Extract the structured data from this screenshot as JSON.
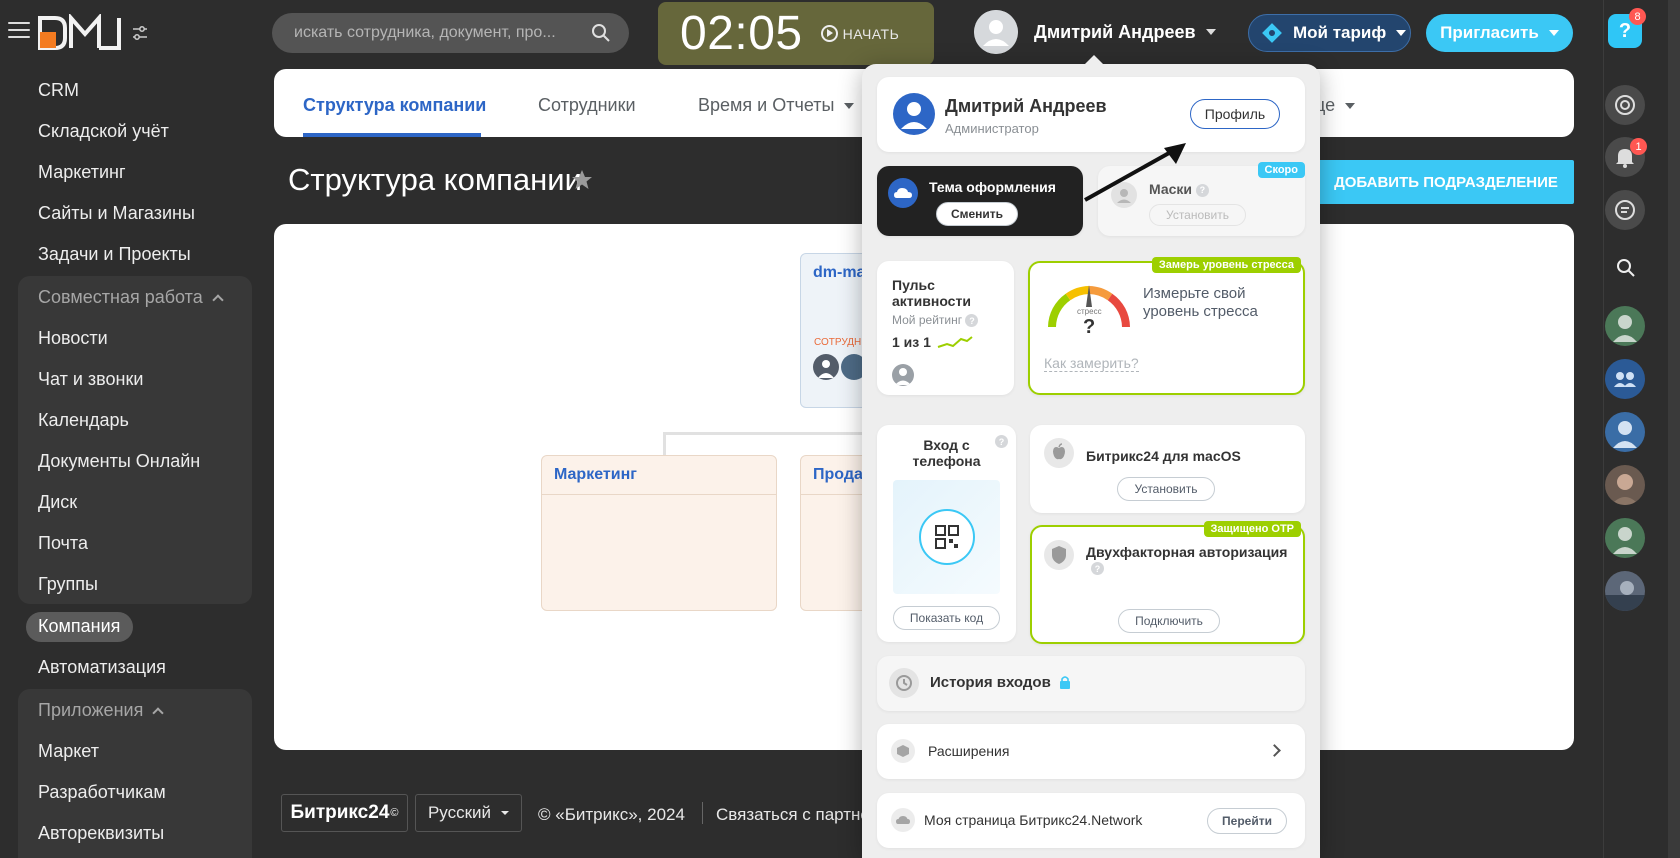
{
  "topbar": {
    "search_placeholder": "искать сотрудника, документ, про...",
    "timer": "02:05",
    "timer_start": "НАЧАТЬ",
    "user_name": "Дмитрий Андреев",
    "tariff_label": "Мой тариф",
    "invite_label": "Пригласить"
  },
  "rail": {
    "help_badge": "8",
    "notifications_badge": "1"
  },
  "sidebar": {
    "items": [
      {
        "label": "CRM"
      },
      {
        "label": "Складской учёт"
      },
      {
        "label": "Маркетинг"
      },
      {
        "label": "Сайты и Магазины"
      },
      {
        "label": "Задачи и Проекты"
      }
    ],
    "collab_title": "Совместная работа",
    "collab_items": [
      {
        "label": "Новости"
      },
      {
        "label": "Чат и звонки"
      },
      {
        "label": "Календарь"
      },
      {
        "label": "Документы Онлайн"
      },
      {
        "label": "Диск"
      },
      {
        "label": "Почта"
      },
      {
        "label": "Группы"
      }
    ],
    "company": "Компания",
    "automation": "Автоматизация",
    "apps_title": "Приложения",
    "apps_items": [
      {
        "label": "Маркет"
      },
      {
        "label": "Разработчикам"
      },
      {
        "label": "Автореквизиты"
      }
    ]
  },
  "main": {
    "tabs": [
      {
        "label": "Структура компании"
      },
      {
        "label": "Сотрудники"
      },
      {
        "label": "Время и Отчеты"
      },
      {
        "label": "це"
      }
    ],
    "title": "Структура компании",
    "add_button": "ДОБАВИТЬ ПОДРАЗДЕЛЕНИЕ",
    "root_card_title": "dm-ma",
    "root_card_sub": "СОТРУДНИ",
    "dept_marketing": "Маркетинг",
    "dept_sales": "Прода"
  },
  "footer": {
    "logo": "Битрикс24",
    "logo_mark": "©",
    "language": "Русский",
    "copyright": "© «Битрикс», 2024",
    "partner": "Связаться с партнером"
  },
  "popup": {
    "user_name": "Дмитрий Андреев",
    "user_role": "Администратор",
    "profile_btn": "Профиль",
    "theme_title": "Тема оформления",
    "theme_btn": "Сменить",
    "masks_title": "Маски",
    "masks_tag": "Скоро",
    "masks_btn": "Установить",
    "pulse_title": "Пульс активности",
    "pulse_sub": "Мой рейтинг",
    "pulse_rating": "1 из 1",
    "stress_tag": "Замерь уровень стресса",
    "stress_gauge_label": "стресс",
    "stress_value": "?",
    "stress_text": "Измерьте свой уровень стресса",
    "stress_link": "Как замерить?",
    "phone_title": "Вход с телефона",
    "phone_btn": "Показать код",
    "mac_title": "Битрикс24 для macOS",
    "mac_btn": "Установить",
    "otp_tag": "Защищено OTP",
    "otp_title": "Двухфакторная авторизация",
    "otp_btn": "Подключить",
    "history_title": "История входов",
    "ext_title": "Расширения",
    "network_title": "Моя страница Битрикс24.Network",
    "network_btn": "Перейти"
  },
  "colors": {
    "accent": "#2d66c6",
    "invite": "#3bc8f5",
    "timer_bg": "#66673b",
    "stress_green": "#9dcf00"
  }
}
